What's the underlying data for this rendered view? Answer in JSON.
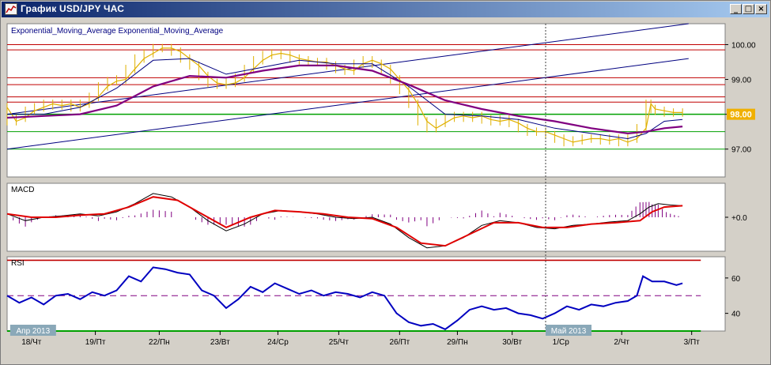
{
  "window": {
    "title": "График USD/JPY ЧАС",
    "buttons": {
      "minimize": "_",
      "maximize": "□",
      "close": "×"
    }
  },
  "colors": {
    "background": "#ffffff",
    "price": "#e0b000",
    "ema_fast": "#000080",
    "ema_slow": "#800080",
    "macd_signal": "#e00000",
    "macd_hist": "#800080",
    "rsi": "#0000c0",
    "resistance": "#c00000",
    "support": "#00a000",
    "channel": "#000080",
    "current_price_bg": "#f0b000"
  },
  "chart_data": [
    {
      "type": "line",
      "title": "Exponential_Moving_Average Exponential_Moving_Average",
      "series_kind": "candlestick-price",
      "y_ticks": [
        97.0,
        98.0,
        99.0,
        100.0
      ],
      "ylim": [
        96.2,
        100.6
      ],
      "current_price_label": "98.00",
      "horizontal_levels": {
        "resistance": [
          100.0,
          99.85,
          99.05,
          98.85,
          98.5,
          98.35
        ],
        "support": [
          98.0,
          97.5,
          97.0
        ]
      },
      "channel_lines": [
        {
          "from": [
            0,
            98.0
          ],
          "to": [
            112,
            100.6
          ]
        },
        {
          "from": [
            0,
            97.0
          ],
          "to": [
            112,
            99.6
          ]
        }
      ],
      "price_points": [
        [
          0,
          98.2
        ],
        [
          1.5,
          97.8
        ],
        [
          3,
          97.9
        ],
        [
          4.5,
          98.1
        ],
        [
          6,
          98.2
        ],
        [
          7.5,
          98.3
        ],
        [
          9,
          98.25
        ],
        [
          10.5,
          98.3
        ],
        [
          12,
          98.2
        ],
        [
          13.5,
          98.3
        ],
        [
          15,
          98.5
        ],
        [
          16.5,
          98.8
        ],
        [
          18,
          98.95
        ],
        [
          19.5,
          99.0
        ],
        [
          21,
          99.3
        ],
        [
          22.5,
          99.6
        ],
        [
          24,
          99.75
        ],
        [
          25.5,
          99.9
        ],
        [
          27,
          99.9
        ],
        [
          28.5,
          99.8
        ],
        [
          30,
          99.6
        ],
        [
          31.5,
          99.4
        ],
        [
          33,
          99.1
        ],
        [
          34.5,
          98.9
        ],
        [
          36,
          98.85
        ],
        [
          37.5,
          98.9
        ],
        [
          39,
          99.05
        ],
        [
          40.5,
          99.3
        ],
        [
          42,
          99.55
        ],
        [
          43.5,
          99.7
        ],
        [
          45,
          99.75
        ],
        [
          46.5,
          99.7
        ],
        [
          48,
          99.6
        ],
        [
          49.5,
          99.55
        ],
        [
          51,
          99.5
        ],
        [
          52.5,
          99.5
        ],
        [
          54,
          99.4
        ],
        [
          55.5,
          99.3
        ],
        [
          57,
          99.25
        ],
        [
          58.5,
          99.45
        ],
        [
          60,
          99.55
        ],
        [
          61.5,
          99.45
        ],
        [
          63,
          99.3
        ],
        [
          64.5,
          99.0
        ],
        [
          66,
          98.7
        ],
        [
          67.5,
          98.3
        ],
        [
          69,
          97.8
        ],
        [
          70.5,
          97.6
        ],
        [
          72,
          97.75
        ],
        [
          73.5,
          97.9
        ],
        [
          75,
          97.95
        ],
        [
          76.5,
          97.9
        ],
        [
          78,
          97.95
        ],
        [
          79.5,
          97.85
        ],
        [
          81,
          97.8
        ],
        [
          82.5,
          97.85
        ],
        [
          84,
          97.75
        ],
        [
          85.5,
          97.6
        ],
        [
          87,
          97.5
        ],
        [
          88.5,
          97.5
        ],
        [
          90,
          97.4
        ],
        [
          91.5,
          97.3
        ],
        [
          93,
          97.2
        ],
        [
          94.5,
          97.25
        ],
        [
          96,
          97.3
        ],
        [
          97.5,
          97.3
        ],
        [
          99,
          97.25
        ],
        [
          100.5,
          97.3
        ],
        [
          102,
          97.2
        ],
        [
          103.5,
          97.3
        ],
        [
          105,
          97.6
        ],
        [
          105.8,
          98.3
        ],
        [
          106.5,
          98.15
        ],
        [
          108,
          98.1
        ],
        [
          109.5,
          98.05
        ],
        [
          111,
          98.05
        ]
      ],
      "ema_fast_points": [
        [
          0,
          98.0
        ],
        [
          6,
          98.0
        ],
        [
          12,
          98.2
        ],
        [
          18,
          98.75
        ],
        [
          24,
          99.55
        ],
        [
          30,
          99.6
        ],
        [
          36,
          99.15
        ],
        [
          42,
          99.35
        ],
        [
          48,
          99.55
        ],
        [
          54,
          99.45
        ],
        [
          60,
          99.45
        ],
        [
          66,
          98.8
        ],
        [
          72,
          98.0
        ],
        [
          78,
          97.95
        ],
        [
          84,
          97.85
        ],
        [
          90,
          97.6
        ],
        [
          96,
          97.45
        ],
        [
          102,
          97.3
        ],
        [
          105,
          97.45
        ],
        [
          108,
          97.8
        ],
        [
          111,
          97.85
        ]
      ],
      "ema_slow_points": [
        [
          0,
          97.9
        ],
        [
          6,
          97.95
        ],
        [
          12,
          98.0
        ],
        [
          18,
          98.25
        ],
        [
          24,
          98.8
        ],
        [
          30,
          99.1
        ],
        [
          36,
          99.05
        ],
        [
          42,
          99.25
        ],
        [
          48,
          99.4
        ],
        [
          54,
          99.4
        ],
        [
          60,
          99.25
        ],
        [
          66,
          98.85
        ],
        [
          72,
          98.4
        ],
        [
          78,
          98.15
        ],
        [
          84,
          97.95
        ],
        [
          90,
          97.8
        ],
        [
          96,
          97.6
        ],
        [
          102,
          97.45
        ],
        [
          105,
          97.5
        ],
        [
          108,
          97.6
        ],
        [
          111,
          97.65
        ]
      ]
    },
    {
      "type": "line",
      "title": "MACD",
      "y_ticks": [
        0.0
      ],
      "y_tick_labels": [
        "+0.0"
      ],
      "ylim": [
        -0.5,
        0.5
      ],
      "macd_points": [
        [
          0,
          0.05
        ],
        [
          3,
          -0.05
        ],
        [
          6,
          0.0
        ],
        [
          9,
          0.02
        ],
        [
          12,
          0.05
        ],
        [
          15,
          0.02
        ],
        [
          18,
          0.08
        ],
        [
          21,
          0.2
        ],
        [
          24,
          0.35
        ],
        [
          27,
          0.3
        ],
        [
          30,
          0.15
        ],
        [
          33,
          -0.05
        ],
        [
          36,
          -0.2
        ],
        [
          39,
          -0.1
        ],
        [
          42,
          0.05
        ],
        [
          45,
          0.1
        ],
        [
          48,
          0.08
        ],
        [
          51,
          0.05
        ],
        [
          54,
          0.0
        ],
        [
          57,
          -0.02
        ],
        [
          60,
          0.0
        ],
        [
          63,
          -0.1
        ],
        [
          66,
          -0.3
        ],
        [
          69,
          -0.45
        ],
        [
          72,
          -0.42
        ],
        [
          75,
          -0.3
        ],
        [
          78,
          -0.12
        ],
        [
          81,
          -0.05
        ],
        [
          84,
          -0.08
        ],
        [
          87,
          -0.15
        ],
        [
          90,
          -0.17
        ],
        [
          93,
          -0.12
        ],
        [
          96,
          -0.1
        ],
        [
          99,
          -0.07
        ],
        [
          102,
          -0.05
        ],
        [
          104,
          0.05
        ],
        [
          105.5,
          0.15
        ],
        [
          107,
          0.2
        ],
        [
          109,
          0.18
        ],
        [
          111,
          0.17
        ]
      ],
      "signal_points": [
        [
          0,
          0.05
        ],
        [
          4,
          0.0
        ],
        [
          8,
          0.0
        ],
        [
          12,
          0.03
        ],
        [
          16,
          0.05
        ],
        [
          20,
          0.15
        ],
        [
          24,
          0.3
        ],
        [
          28,
          0.25
        ],
        [
          32,
          0.05
        ],
        [
          36,
          -0.15
        ],
        [
          40,
          0.0
        ],
        [
          44,
          0.1
        ],
        [
          48,
          0.08
        ],
        [
          52,
          0.05
        ],
        [
          56,
          0.0
        ],
        [
          60,
          -0.02
        ],
        [
          64,
          -0.15
        ],
        [
          68,
          -0.38
        ],
        [
          72,
          -0.42
        ],
        [
          76,
          -0.25
        ],
        [
          80,
          -0.08
        ],
        [
          84,
          -0.08
        ],
        [
          88,
          -0.15
        ],
        [
          92,
          -0.15
        ],
        [
          96,
          -0.1
        ],
        [
          100,
          -0.08
        ],
        [
          104,
          -0.05
        ],
        [
          106,
          0.08
        ],
        [
          108,
          0.15
        ],
        [
          111,
          0.17
        ]
      ]
    },
    {
      "type": "line",
      "title": "RSI",
      "y_ticks": [
        40,
        60
      ],
      "ylim": [
        30,
        72
      ],
      "levels": {
        "upper": 70,
        "middle": 50,
        "lower": 30
      },
      "rsi_points": [
        [
          0,
          50
        ],
        [
          2,
          46
        ],
        [
          4,
          49
        ],
        [
          6,
          45
        ],
        [
          8,
          50
        ],
        [
          10,
          51
        ],
        [
          12,
          48
        ],
        [
          14,
          52
        ],
        [
          16,
          50
        ],
        [
          18,
          53
        ],
        [
          20,
          61
        ],
        [
          22,
          58
        ],
        [
          24,
          66
        ],
        [
          26,
          65
        ],
        [
          28,
          63
        ],
        [
          30,
          62
        ],
        [
          32,
          53
        ],
        [
          34,
          50
        ],
        [
          36,
          43
        ],
        [
          38,
          48
        ],
        [
          40,
          55
        ],
        [
          42,
          52
        ],
        [
          44,
          57
        ],
        [
          46,
          54
        ],
        [
          48,
          51
        ],
        [
          50,
          53
        ],
        [
          52,
          50
        ],
        [
          54,
          52
        ],
        [
          56,
          51
        ],
        [
          58,
          49
        ],
        [
          60,
          52
        ],
        [
          62,
          50
        ],
        [
          64,
          40
        ],
        [
          66,
          35
        ],
        [
          68,
          33
        ],
        [
          70,
          34
        ],
        [
          72,
          31
        ],
        [
          74,
          36
        ],
        [
          76,
          42
        ],
        [
          78,
          44
        ],
        [
          80,
          42
        ],
        [
          82,
          43
        ],
        [
          84,
          40
        ],
        [
          86,
          39
        ],
        [
          88,
          37
        ],
        [
          90,
          40
        ],
        [
          92,
          44
        ],
        [
          94,
          42
        ],
        [
          96,
          45
        ],
        [
          98,
          44
        ],
        [
          100,
          46
        ],
        [
          102,
          47
        ],
        [
          103.5,
          50
        ],
        [
          104.5,
          61
        ],
        [
          106,
          58
        ],
        [
          108,
          58
        ],
        [
          110,
          56
        ],
        [
          111,
          57
        ]
      ]
    }
  ],
  "x_axis": {
    "range": [
      0,
      118
    ],
    "date_markers": [
      {
        "label": "Апр 2013",
        "x": 0.5
      },
      {
        "label": "Май 2013",
        "x": 88.5
      }
    ],
    "month_separator_x": 88.5,
    "ticks": [
      {
        "x": 4.0,
        "label": "18/Чт"
      },
      {
        "x": 14.5,
        "label": "19/Пт"
      },
      {
        "x": 25.0,
        "label": "22/Пн"
      },
      {
        "x": 35.0,
        "label": "23/Вт"
      },
      {
        "x": 44.5,
        "label": "24/Ср"
      },
      {
        "x": 54.5,
        "label": "25/Чт"
      },
      {
        "x": 64.5,
        "label": "26/Пт"
      },
      {
        "x": 74.0,
        "label": "29/Пн"
      },
      {
        "x": 83.0,
        "label": "30/Вт"
      },
      {
        "x": 91.0,
        "label": "1/Ср"
      },
      {
        "x": 101.0,
        "label": "2/Чт"
      },
      {
        "x": 112.5,
        "label": "3/Пт"
      }
    ]
  }
}
